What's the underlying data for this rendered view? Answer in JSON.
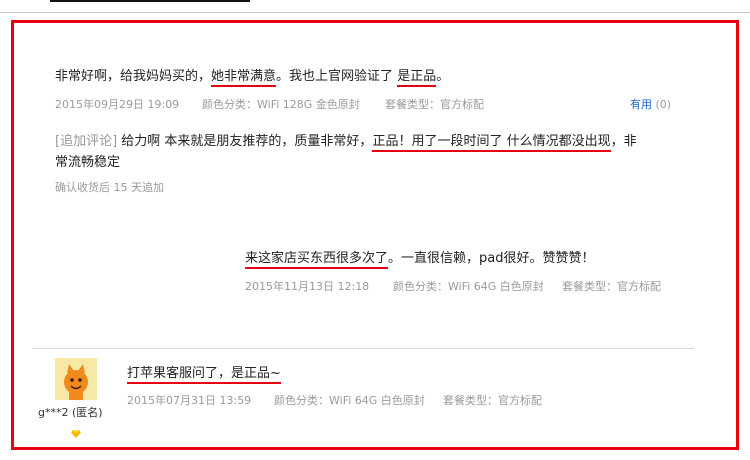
{
  "review1": {
    "text_part1": "非常好啊，给我妈妈买的，",
    "text_highlight": "她非常满意",
    "text_part2": "。我也上官网验证了",
    "text_highlight2": "是正品",
    "text_part3": "。",
    "date": "2015年09月29日 19:09",
    "color_label": "颜色分类：",
    "color_value": "WiFi 128G 金色原封",
    "package_label": "套餐类型：",
    "package_value": "官方标配",
    "useful_label": "有用",
    "useful_count": "(0)",
    "followup_tag": "[追加评论]",
    "followup_text1": "给力啊 本来就是朋友推荐的，质量非常好，",
    "followup_highlight": "正品！用了一段时间了 什么情况都没出现",
    "followup_text2": "，非",
    "followup_line2": "常流畅稳定",
    "followup_note": "确认收货后 15 天追加"
  },
  "review2": {
    "text_highlight": "来这家店买东西很多次了",
    "text_rest": "。一直很信赖，pad很好。赞赞赞！",
    "date": "2015年11月13日 12:18",
    "color_label": "颜色分类：",
    "color_value": "WiFi 64G 白色原封",
    "package_label": "套餐类型：",
    "package_value": "官方标配"
  },
  "review3": {
    "text_highlight": "打苹果客服问了，是正品~",
    "date": "2015年07月31日 13:59",
    "color_label": "颜色分类：",
    "color_value": "WiFi 64G 白色原封",
    "package_label": "套餐类型：",
    "package_value": "官方标配",
    "username": "g***2 (匿名)",
    "avatar_icon": "orange-mascot-icon",
    "badge_icon": "diamond-vip-icon"
  },
  "colors": {
    "highlight_underline": "#e60012",
    "frame_border": "#e60012",
    "useful_link": "#1a66cc",
    "meta_text": "#9a9a9a"
  }
}
